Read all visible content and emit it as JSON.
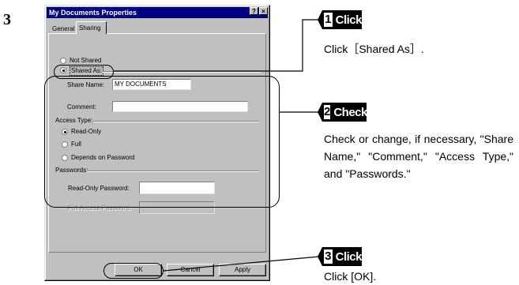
{
  "step_number": "3",
  "dialog": {
    "title": "My Documents Properties",
    "help_btn": "?",
    "close_btn": "×",
    "tabs": [
      "General",
      "Sharing"
    ],
    "not_shared": "Not Shared",
    "shared_as": "Shared As:",
    "share_name_label": "Share Name:",
    "share_name_value": "MY DOCUMENTS",
    "comment_label": "Comment:",
    "comment_value": "",
    "access_type_label": "Access Type:",
    "access_options": [
      "Read-Only",
      "Full",
      "Depends on Password"
    ],
    "passwords_label": "Passwords:",
    "readonly_pw_label": "Read-Only Password:",
    "full_pw_label": "Full Access Password:",
    "ok": "OK",
    "cancel": "Cancel",
    "apply": "Apply"
  },
  "annotations": [
    {
      "num": "1",
      "word": "Click",
      "text": "Click［Shared As］."
    },
    {
      "num": "2",
      "word": "Check",
      "text": "Check or change, if necessary, \"Share Name,\" \"Comment,\" \"Access Type,\" and \"Passwords.\""
    },
    {
      "num": "3",
      "word": "Click",
      "text": "Click [OK]."
    }
  ]
}
